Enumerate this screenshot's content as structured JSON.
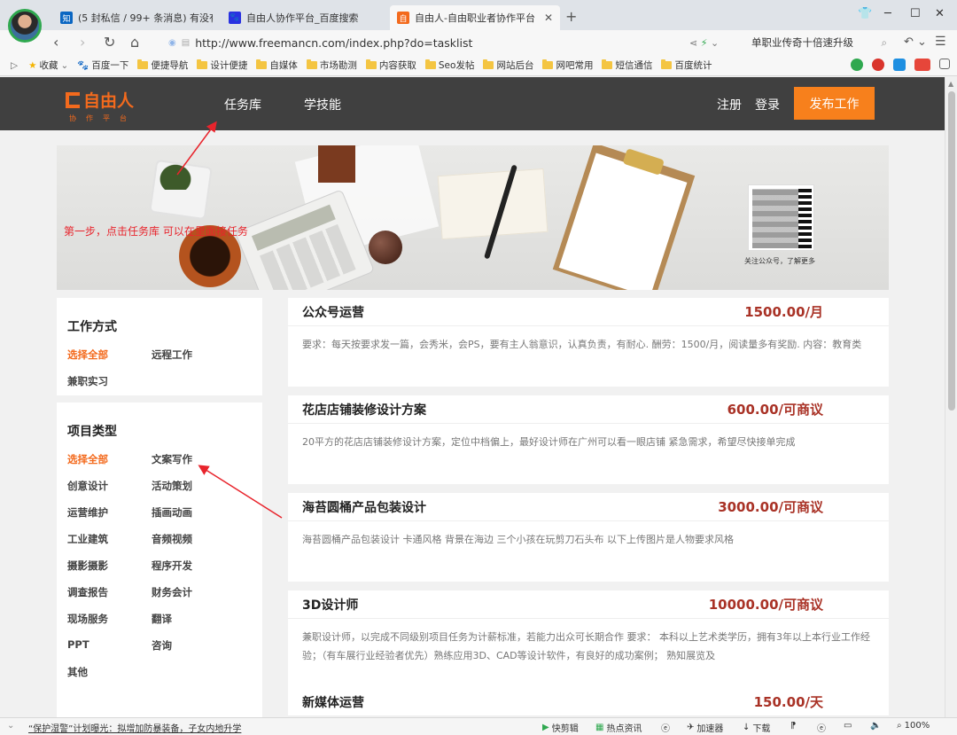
{
  "browser": {
    "tabs": [
      {
        "label": "(5 封私信 / 99+ 条消息) 有没有…",
        "favicon": "知",
        "color": "#0a66c2"
      },
      {
        "label": "自由人协作平台_百度搜索",
        "favicon": "🐾",
        "color": "#2932e1"
      },
      {
        "label": "自由人-自由职业者协作平台",
        "favicon": "自",
        "color": "#f36a1d",
        "active": true
      }
    ],
    "new_tab": "+",
    "url": "http://www.freemancn.com/index.php?do=tasklist",
    "search_text": "单职业传奇十倍速升级",
    "bookmarks": [
      "收藏",
      "百度一下",
      "便捷导航",
      "设计便捷",
      "自媒体",
      "市场勘测",
      "内容获取",
      "Seo发帖",
      "网站后台",
      "网吧常用",
      "短信通信",
      "百度统计"
    ],
    "status": {
      "news": "“保护湿警”计划曝光：拟增加防暴装备，子女内地升学",
      "items": [
        "快剪辑",
        "热点资讯",
        "加速器",
        "下载"
      ],
      "zoom": "100%"
    }
  },
  "site": {
    "logo_text": "自由人",
    "logo_sub": "协作平台",
    "nav": [
      "任务库",
      "学技能"
    ],
    "register": "注册",
    "login": "登录",
    "publish": "发布工作",
    "banner_caption": "关注公众号，了解更多"
  },
  "annotation": "第一步，点击任务库 可以在里面接任务",
  "sidebar": {
    "work_title": "工作方式",
    "work_items": [
      "选择全部",
      "远程工作",
      "兼职实习"
    ],
    "type_title": "项目类型",
    "type_items": [
      "选择全部",
      "文案写作",
      "创意设计",
      "活动策划",
      "运营维护",
      "插画动画",
      "工业建筑",
      "音频视频",
      "摄影摄影",
      "程序开发",
      "调查报告",
      "财务会计",
      "现场服务",
      "翻译",
      "PPT",
      "咨询",
      "其他"
    ]
  },
  "tasks": [
    {
      "title": "公众号运营",
      "price": "1500.00/月",
      "desc": "要求：每天按要求发一篇，会秀米，会PS，要有主人翁意识，认真负责，有耐心. 酬劳：1500/月，阅读量多有奖励. 内容：教育类"
    },
    {
      "title": "花店店铺装修设计方案",
      "price": "600.00/可商议",
      "desc": "20平方的花店店铺装修设计方案，定位中档偏上，最好设计师在广州可以看一眼店铺 紧急需求，希望尽快接单完成"
    },
    {
      "title": "海苔圆桶产品包装设计",
      "price": "3000.00/可商议",
      "desc": "海苔圆桶产品包装设计 卡通风格 背景在海边 三个小孩在玩剪刀石头布 以下上传图片是人物要求风格"
    },
    {
      "title": "3D设计师",
      "price": "10000.00/可商议",
      "desc": "兼职设计师，以完成不同级别项目任务为计薪标准，若能力出众可长期合作 要求： 本科以上艺术类学历，拥有3年以上本行业工作经验；（有车展行业经验者优先）熟练应用3D、CAD等设计软件，有良好的成功案例； 熟知展览及"
    },
    {
      "title": "新媒体运营",
      "price": "150.00/天",
      "desc": ""
    }
  ]
}
